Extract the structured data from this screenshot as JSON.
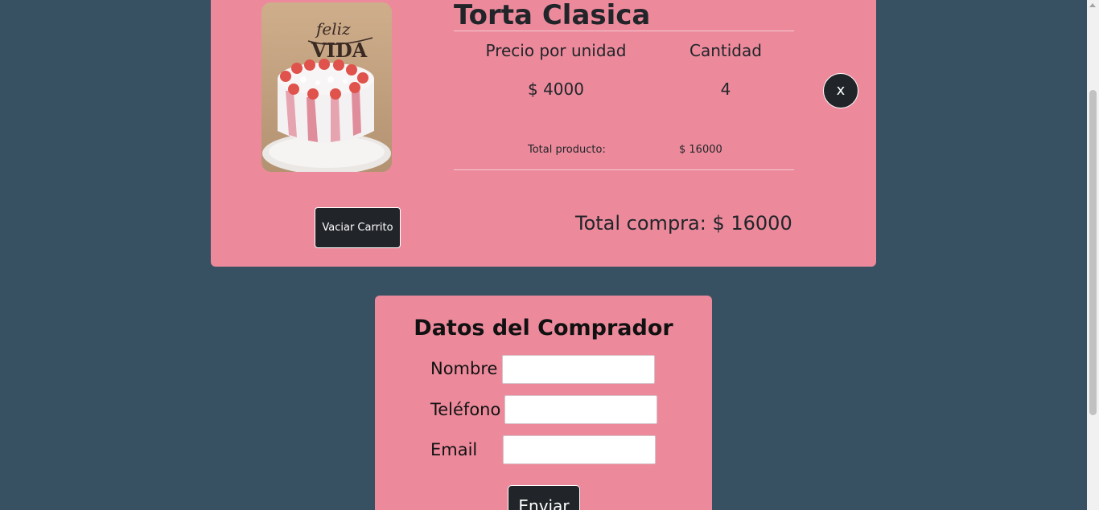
{
  "cart": {
    "product": {
      "title": "Torta Clasica",
      "image_icon": "cake-photo",
      "image_caption": "feliz VIDA",
      "price_header": "Precio por unidad",
      "quantity_header": "Cantidad",
      "price": "$ 4000",
      "quantity": "4",
      "total_label": "Total producto:",
      "total_value": "$ 16000",
      "remove_label": "x"
    },
    "clear_label": "Vaciar Carrito",
    "total_purchase": "Total compra: $ 16000"
  },
  "buyer": {
    "title": "Datos del Comprador",
    "name_label": "Nombre",
    "name_value": "",
    "phone_label": "Teléfono",
    "phone_value": "",
    "email_label": "Email",
    "email_value": "",
    "send_label": "Enviar"
  },
  "colors": {
    "background": "#375163",
    "card": "#ec8a9c",
    "button": "#212529"
  }
}
